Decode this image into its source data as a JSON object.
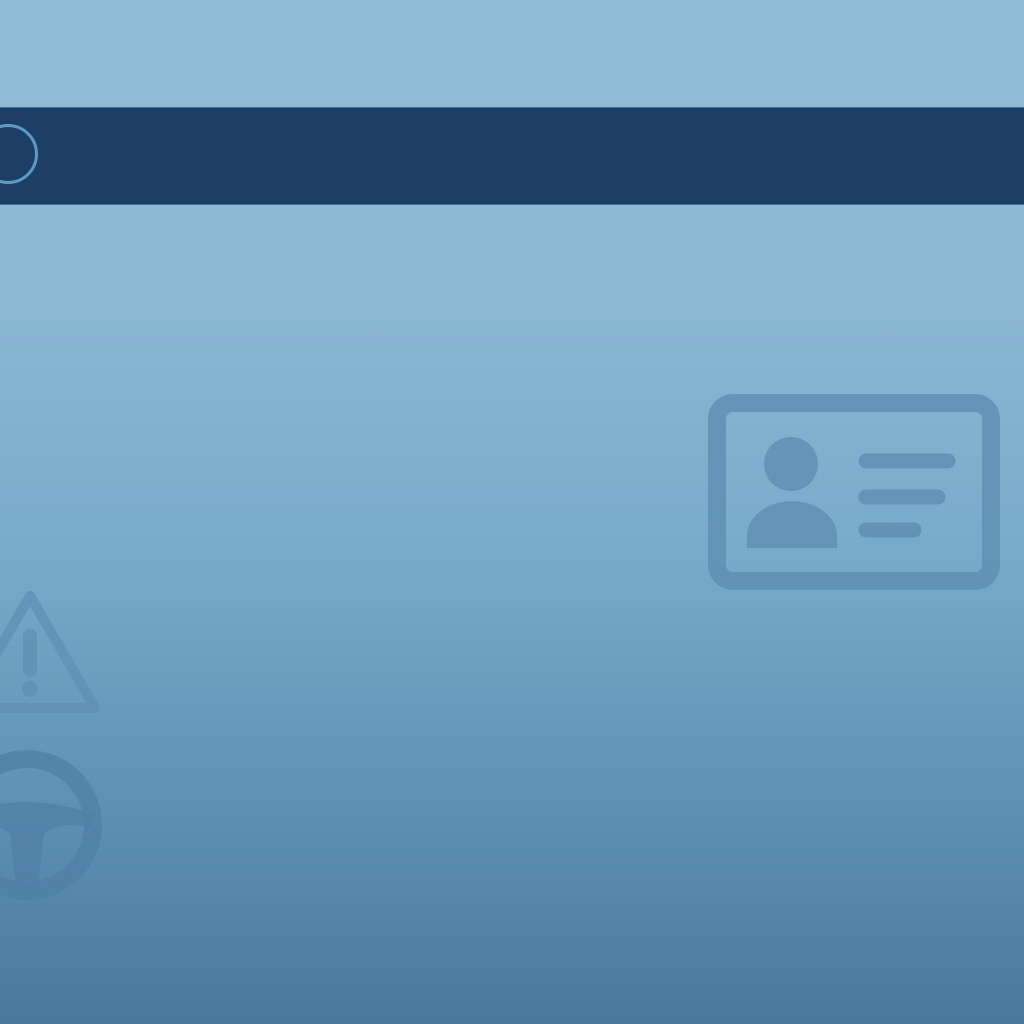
{
  "background": {
    "gradient_top": "#8fbcd6",
    "gradient_bottom": "#4a779d"
  },
  "banner": {
    "color": "#1d3f65",
    "ring_color": "#5f9ac6",
    "icon": "circle-outline"
  },
  "icons": [
    {
      "name": "id-card-icon",
      "color": "#5f8fb4"
    },
    {
      "name": "warning-triangle-icon",
      "color": "#5f8fb4"
    },
    {
      "name": "steering-wheel-icon",
      "color": "#4f7fa6"
    }
  ]
}
